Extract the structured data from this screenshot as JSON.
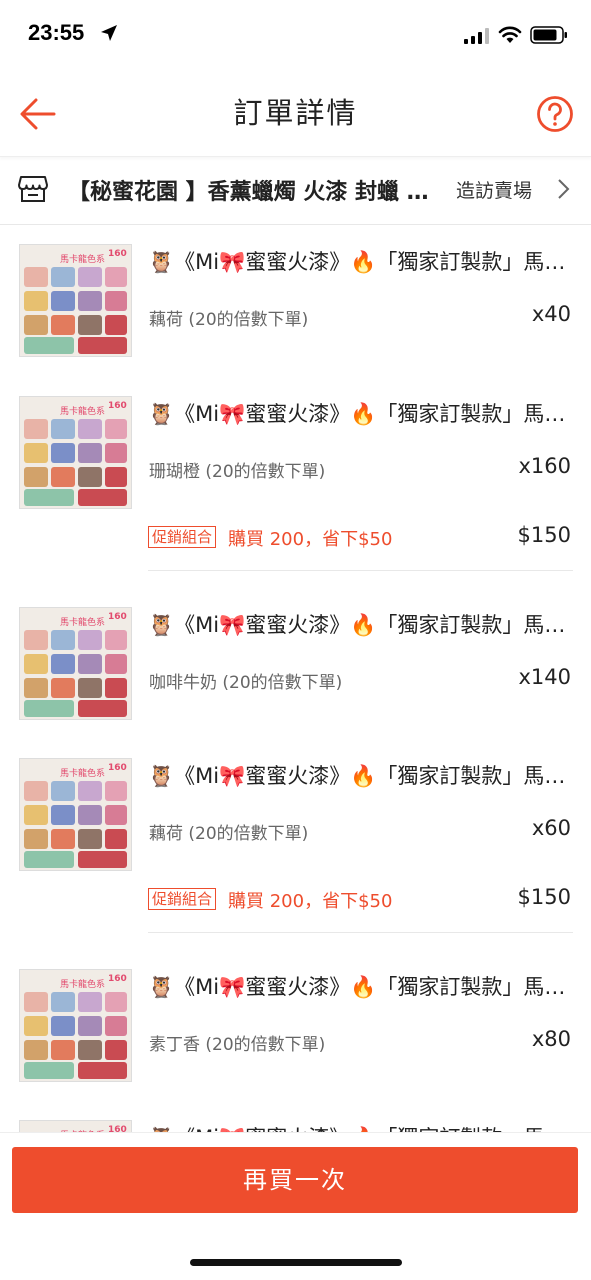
{
  "status_bar": {
    "time": "23:55"
  },
  "header": {
    "title": "訂單詳情"
  },
  "shop": {
    "name": "【秘蜜花園 】香薰蠟燭 火漆 封蠟 手作",
    "visit_label": "造訪賣場"
  },
  "items": [
    {
      "title": "🦉《Mi🎀蜜蜜火漆》🔥「獨家訂製款」馬卡龍色系",
      "variant": "藕荷 (20的倍數下單)",
      "qty": "x40"
    },
    {
      "title": "🦉《Mi🎀蜜蜜火漆》🔥「獨家訂製款」馬卡龍色系",
      "variant": "珊瑚橙 (20的倍數下單)",
      "qty": "x160"
    },
    {
      "title": "🦉《Mi🎀蜜蜜火漆》🔥「獨家訂製款」馬卡龍色系",
      "variant": "咖啡牛奶 (20的倍數下單)",
      "qty": "x140"
    },
    {
      "title": "🦉《Mi🎀蜜蜜火漆》🔥「獨家訂製款」馬卡龍色系",
      "variant": "藕荷 (20的倍數下單)",
      "qty": "x60"
    },
    {
      "title": "🦉《Mi🎀蜜蜜火漆》🔥「獨家訂製款」馬卡龍色系",
      "variant": "素丁香 (20的倍數下單)",
      "qty": "x80"
    },
    {
      "title": "🦉《Mi🎀蜜蜜火漆》🔥「獨家訂製款」馬卡龍色系"
    }
  ],
  "promos": [
    {
      "tag": "促銷組合",
      "text": "購買 200，省下$50",
      "price": "$150"
    },
    {
      "tag": "促銷組合",
      "text": "購買 200，省下$50",
      "price": "$150"
    }
  ],
  "thumbnail": {
    "overlay_text": "馬卡龍色系",
    "badge": "160"
  },
  "bottom_bar": {
    "buy_again_label": "再買一次"
  },
  "colors": {
    "accent": "#ee4d2d",
    "text": "#222222",
    "muted": "#666666"
  }
}
